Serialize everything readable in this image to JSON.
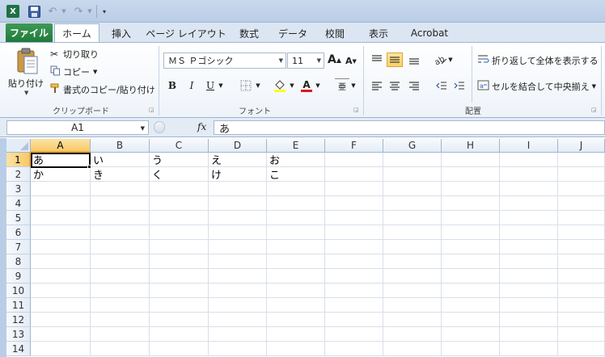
{
  "quick_access": {
    "app_logo": "X",
    "undo_arrow": "↶",
    "redo_arrow": "↷"
  },
  "tabs": [
    {
      "label": "ファイル"
    },
    {
      "label": "ホーム"
    },
    {
      "label": "挿入"
    },
    {
      "label": "ページ レイアウト"
    },
    {
      "label": "数式"
    },
    {
      "label": "データ"
    },
    {
      "label": "校閲"
    },
    {
      "label": "表示"
    },
    {
      "label": "Acrobat"
    }
  ],
  "ribbon": {
    "clipboard": {
      "paste_label": "貼り付け",
      "cut_label": "切り取り",
      "copy_label": "コピー",
      "format_painter_label": "書式のコピー/貼り付け",
      "group_label": "クリップボード"
    },
    "font": {
      "font_name": "ＭＳ Ｐゴシック",
      "font_size": "11",
      "grow_label": "A",
      "shrink_label": "A",
      "bold_label": "B",
      "italic_label": "I",
      "underline_label": "U",
      "font_color_label": "A",
      "phonetic_label": "亜",
      "group_label": "フォント"
    },
    "alignment": {
      "wrap_label": "折り返して全体を表示する",
      "merge_label": "セルを結合して中央揃え",
      "group_label": "配置"
    }
  },
  "formula_bar": {
    "name_box": "A1",
    "fx_label": "fx",
    "content": "あ"
  },
  "sheet": {
    "columns": [
      "A",
      "B",
      "C",
      "D",
      "E",
      "F",
      "G",
      "H",
      "I",
      "J"
    ],
    "rows": [
      "1",
      "2",
      "3",
      "4",
      "5",
      "6",
      "7",
      "8",
      "9",
      "10",
      "11",
      "12",
      "13",
      "14"
    ],
    "cells": [
      [
        "あ",
        "い",
        "う",
        "え",
        "お",
        "",
        "",
        "",
        "",
        ""
      ],
      [
        "か",
        "き",
        "く",
        "け",
        "こ",
        "",
        "",
        "",
        "",
        ""
      ]
    ]
  },
  "colors": {
    "file_tab": "#1f7a3c",
    "selection_header": "#f8c968",
    "gridline": "#d9dfe7"
  }
}
